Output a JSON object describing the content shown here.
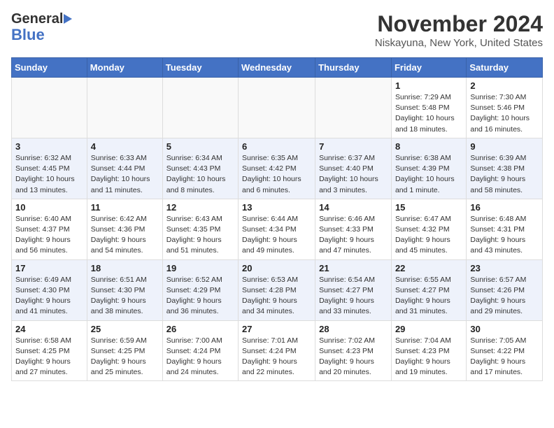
{
  "header": {
    "logo_general": "General",
    "logo_blue": "Blue",
    "month": "November 2024",
    "location": "Niskayuna, New York, United States"
  },
  "weekdays": [
    "Sunday",
    "Monday",
    "Tuesday",
    "Wednesday",
    "Thursday",
    "Friday",
    "Saturday"
  ],
  "weeks": [
    [
      {
        "day": "",
        "info": ""
      },
      {
        "day": "",
        "info": ""
      },
      {
        "day": "",
        "info": ""
      },
      {
        "day": "",
        "info": ""
      },
      {
        "day": "",
        "info": ""
      },
      {
        "day": "1",
        "info": "Sunrise: 7:29 AM\nSunset: 5:48 PM\nDaylight: 10 hours and 18 minutes."
      },
      {
        "day": "2",
        "info": "Sunrise: 7:30 AM\nSunset: 5:46 PM\nDaylight: 10 hours and 16 minutes."
      }
    ],
    [
      {
        "day": "3",
        "info": "Sunrise: 6:32 AM\nSunset: 4:45 PM\nDaylight: 10 hours and 13 minutes."
      },
      {
        "day": "4",
        "info": "Sunrise: 6:33 AM\nSunset: 4:44 PM\nDaylight: 10 hours and 11 minutes."
      },
      {
        "day": "5",
        "info": "Sunrise: 6:34 AM\nSunset: 4:43 PM\nDaylight: 10 hours and 8 minutes."
      },
      {
        "day": "6",
        "info": "Sunrise: 6:35 AM\nSunset: 4:42 PM\nDaylight: 10 hours and 6 minutes."
      },
      {
        "day": "7",
        "info": "Sunrise: 6:37 AM\nSunset: 4:40 PM\nDaylight: 10 hours and 3 minutes."
      },
      {
        "day": "8",
        "info": "Sunrise: 6:38 AM\nSunset: 4:39 PM\nDaylight: 10 hours and 1 minute."
      },
      {
        "day": "9",
        "info": "Sunrise: 6:39 AM\nSunset: 4:38 PM\nDaylight: 9 hours and 58 minutes."
      }
    ],
    [
      {
        "day": "10",
        "info": "Sunrise: 6:40 AM\nSunset: 4:37 PM\nDaylight: 9 hours and 56 minutes."
      },
      {
        "day": "11",
        "info": "Sunrise: 6:42 AM\nSunset: 4:36 PM\nDaylight: 9 hours and 54 minutes."
      },
      {
        "day": "12",
        "info": "Sunrise: 6:43 AM\nSunset: 4:35 PM\nDaylight: 9 hours and 51 minutes."
      },
      {
        "day": "13",
        "info": "Sunrise: 6:44 AM\nSunset: 4:34 PM\nDaylight: 9 hours and 49 minutes."
      },
      {
        "day": "14",
        "info": "Sunrise: 6:46 AM\nSunset: 4:33 PM\nDaylight: 9 hours and 47 minutes."
      },
      {
        "day": "15",
        "info": "Sunrise: 6:47 AM\nSunset: 4:32 PM\nDaylight: 9 hours and 45 minutes."
      },
      {
        "day": "16",
        "info": "Sunrise: 6:48 AM\nSunset: 4:31 PM\nDaylight: 9 hours and 43 minutes."
      }
    ],
    [
      {
        "day": "17",
        "info": "Sunrise: 6:49 AM\nSunset: 4:30 PM\nDaylight: 9 hours and 41 minutes."
      },
      {
        "day": "18",
        "info": "Sunrise: 6:51 AM\nSunset: 4:30 PM\nDaylight: 9 hours and 38 minutes."
      },
      {
        "day": "19",
        "info": "Sunrise: 6:52 AM\nSunset: 4:29 PM\nDaylight: 9 hours and 36 minutes."
      },
      {
        "day": "20",
        "info": "Sunrise: 6:53 AM\nSunset: 4:28 PM\nDaylight: 9 hours and 34 minutes."
      },
      {
        "day": "21",
        "info": "Sunrise: 6:54 AM\nSunset: 4:27 PM\nDaylight: 9 hours and 33 minutes."
      },
      {
        "day": "22",
        "info": "Sunrise: 6:55 AM\nSunset: 4:27 PM\nDaylight: 9 hours and 31 minutes."
      },
      {
        "day": "23",
        "info": "Sunrise: 6:57 AM\nSunset: 4:26 PM\nDaylight: 9 hours and 29 minutes."
      }
    ],
    [
      {
        "day": "24",
        "info": "Sunrise: 6:58 AM\nSunset: 4:25 PM\nDaylight: 9 hours and 27 minutes."
      },
      {
        "day": "25",
        "info": "Sunrise: 6:59 AM\nSunset: 4:25 PM\nDaylight: 9 hours and 25 minutes."
      },
      {
        "day": "26",
        "info": "Sunrise: 7:00 AM\nSunset: 4:24 PM\nDaylight: 9 hours and 24 minutes."
      },
      {
        "day": "27",
        "info": "Sunrise: 7:01 AM\nSunset: 4:24 PM\nDaylight: 9 hours and 22 minutes."
      },
      {
        "day": "28",
        "info": "Sunrise: 7:02 AM\nSunset: 4:23 PM\nDaylight: 9 hours and 20 minutes."
      },
      {
        "day": "29",
        "info": "Sunrise: 7:04 AM\nSunset: 4:23 PM\nDaylight: 9 hours and 19 minutes."
      },
      {
        "day": "30",
        "info": "Sunrise: 7:05 AM\nSunset: 4:22 PM\nDaylight: 9 hours and 17 minutes."
      }
    ]
  ]
}
